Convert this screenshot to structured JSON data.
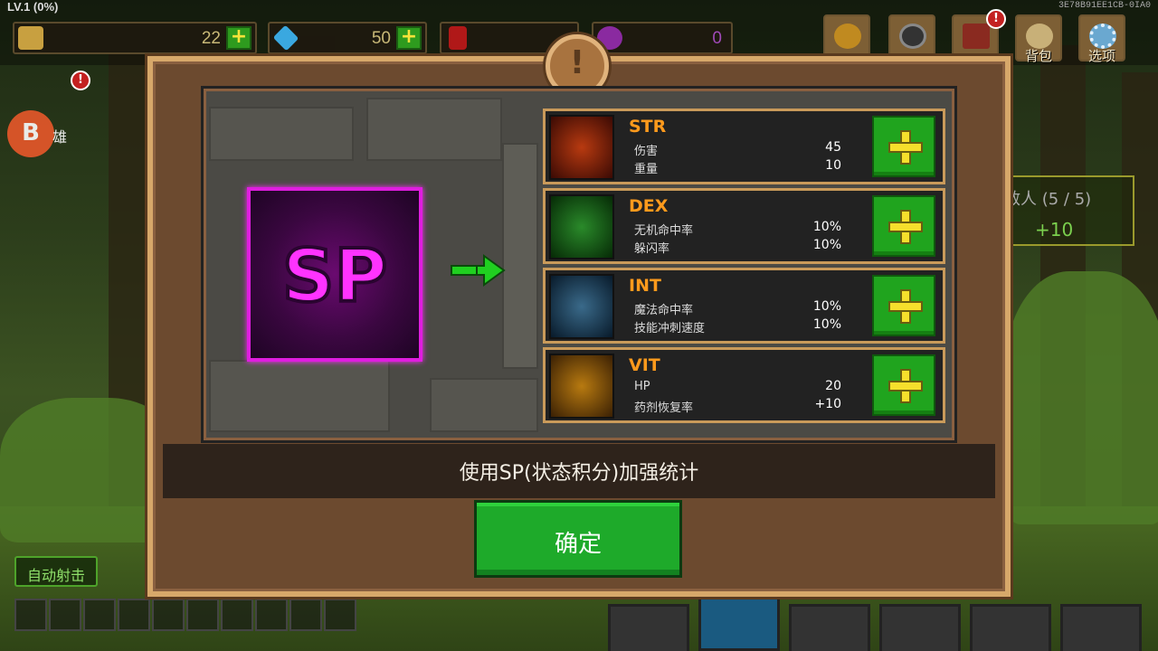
{
  "hud": {
    "level": "LV.1 (0%)",
    "device_id": "3E78B91EE1CB-0IA0",
    "currencies": [
      {
        "name": "gold",
        "amount": "22",
        "icon": "gold-bag-icon",
        "color": "#c8a040"
      },
      {
        "name": "gem",
        "amount": "50",
        "icon": "diamond-icon",
        "color": "#3aa8e0"
      },
      {
        "name": "ruby",
        "amount": "",
        "icon": "ruby-icon",
        "color": "#b01818"
      },
      {
        "name": "soul",
        "amount": "0",
        "icon": "purple-orb-icon",
        "color": "#8a2aa0"
      }
    ],
    "buttons": [
      {
        "icon": "trophy-icon",
        "label": ""
      },
      {
        "icon": "skull-icon",
        "label": ""
      },
      {
        "icon": "book-icon",
        "label": "",
        "alert": "!"
      },
      {
        "icon": "bag-icon",
        "label": "背包"
      },
      {
        "icon": "gear-icon",
        "label": "选项"
      }
    ]
  },
  "left": {
    "hero_badge": "B",
    "hero_label": "雄",
    "alert": "!",
    "auto_fire": "自动射击"
  },
  "enemy_panel": {
    "title": "敌人 (5 / 5)",
    "reward": "+10"
  },
  "modal": {
    "icon": "!",
    "sp_label": "SP",
    "stats": [
      {
        "name": "STR",
        "line1_label": "伤害",
        "line1_value": "45",
        "line2_label": "重量",
        "line2_value": "10",
        "color": "#ff7a10",
        "icon": "str-strength-icon"
      },
      {
        "name": "DEX",
        "line1_label": "无机命中率",
        "line1_value": "10%",
        "line2_label": "躲闪率",
        "line2_value": "10%",
        "color": "#4cc84a",
        "icon": "dex-agility-icon"
      },
      {
        "name": "INT",
        "line1_label": "魔法命中率",
        "line1_value": "10%",
        "line2_label": "技能冲刺速度",
        "line2_value": "10%",
        "color": "#6ab8e0",
        "icon": "int-wizard-icon"
      },
      {
        "name": "VIT",
        "line1_label": "HP",
        "line1_value": "20",
        "line2_label": "药剂恢复率",
        "line2_value": "+10",
        "color": "#f0a020",
        "icon": "vit-muscle-icon"
      }
    ],
    "hint": "使用SP(状态积分)加强统计",
    "confirm": "确定"
  }
}
